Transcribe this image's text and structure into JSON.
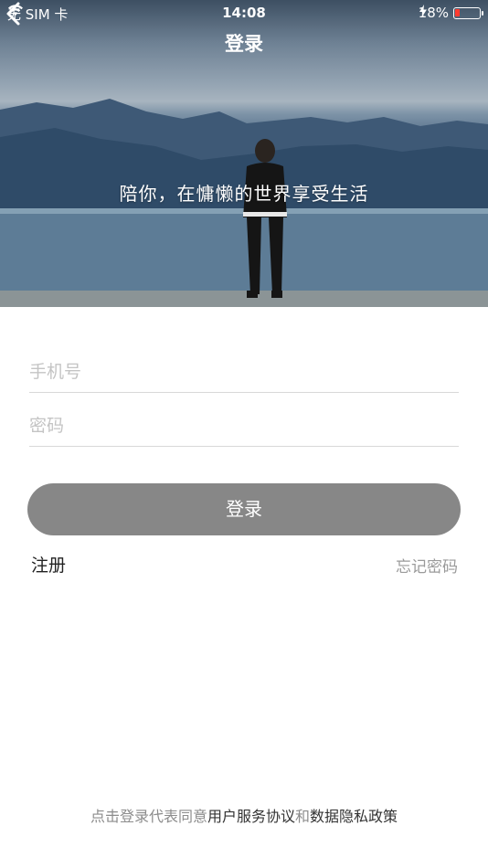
{
  "status_bar": {
    "carrier": "无 SIM 卡",
    "time": "14:08",
    "battery_percent": "18%",
    "battery_level": 0.18,
    "battery_color": "#ff3b30"
  },
  "nav": {
    "title": "登录",
    "back_icon": "chevron-left-icon"
  },
  "hero": {
    "slogan": "陪你，在慵懒的世界享受生活"
  },
  "form": {
    "phone_placeholder": "手机号",
    "password_placeholder": "密码",
    "login_label": "登录",
    "register_label": "注册",
    "forgot_label": "忘记密码"
  },
  "agreement": {
    "prefix": "点击登录代表同意",
    "terms": "用户服务协议",
    "and": "和",
    "privacy": "数据隐私政策"
  },
  "colors": {
    "button_bg": "#878787",
    "placeholder": "#c4c4c4",
    "link_dark": "#333333"
  }
}
